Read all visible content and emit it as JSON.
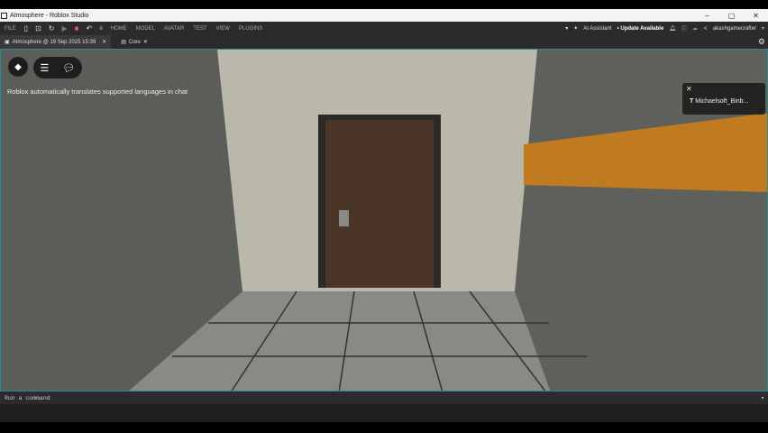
{
  "window": {
    "title": "Atmosphere - Roblox Studio",
    "minimize": "–",
    "maximize": "▢",
    "close": "✕"
  },
  "toolbar": {
    "file": "FILE",
    "menus": [
      "HOME",
      "MODEL",
      "AVATAR",
      "TEST",
      "VIEW",
      "PLUGINS"
    ],
    "ai_assistant": "AI Assistant",
    "update": "• Update Available",
    "user": "akashgamecrafter"
  },
  "tabs": [
    {
      "label": "Atmosphere @ 19 Sep 2025 15:39",
      "close": "✕"
    },
    {
      "label": "Core",
      "close": "✕"
    }
  ],
  "viewport": {
    "chat_notice": "Roblox automatically translates supported languages in chat",
    "notification": {
      "close": "✕",
      "name": "Michaelsoft_Binb..."
    }
  },
  "command_bar": {
    "placeholder": "Run a command",
    "dropdown": "▾"
  }
}
